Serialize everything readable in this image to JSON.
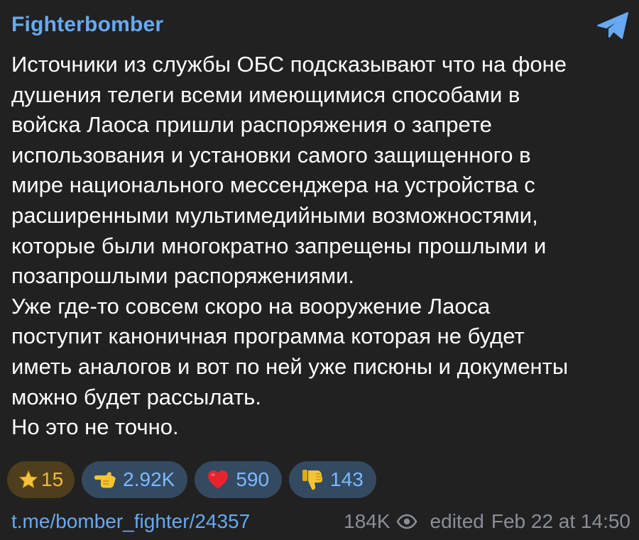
{
  "channel": {
    "name": "Fighterbomber"
  },
  "message": {
    "text": "Источники из службы ОБС подсказывают что на фоне\nдушения телеги всеми имеющимися способами в\nвойска Лаоса пришли распоряжения о запрете\nиспользования и установки самого защищенного в\nмире национального мессенджера на устройства с\nрасширенными мультимедийными возможностями,\nкоторые были многократно запрещены прошлыми и\nпозапрошлыми распоряжениями.\nУже где-то совсем скоро на вооружение Лаоса\nпоступит каноничная программа которая не будет\nиметь аналогов и вот по ней уже писюны и документы\nможно будет рассылать.\nНо это не точно."
  },
  "reactions": [
    {
      "icon": "star-icon",
      "count": "15"
    },
    {
      "icon": "pointing-hand-icon",
      "count": "2.92K"
    },
    {
      "icon": "heart-icon",
      "count": "590"
    },
    {
      "icon": "thumbs-down-icon",
      "count": "143"
    }
  ],
  "footer": {
    "link": "t.me/bomber_fighter/24357",
    "views": "184K",
    "edited_label": "edited",
    "date": "Feb 22 at 14:50"
  },
  "colors": {
    "background": "#212121",
    "accent": "#67a9f2",
    "reaction_bg": "#344a61",
    "star_bg": "#4d3e1c",
    "star_text": "#f3b744",
    "muted": "#8a8f96"
  }
}
